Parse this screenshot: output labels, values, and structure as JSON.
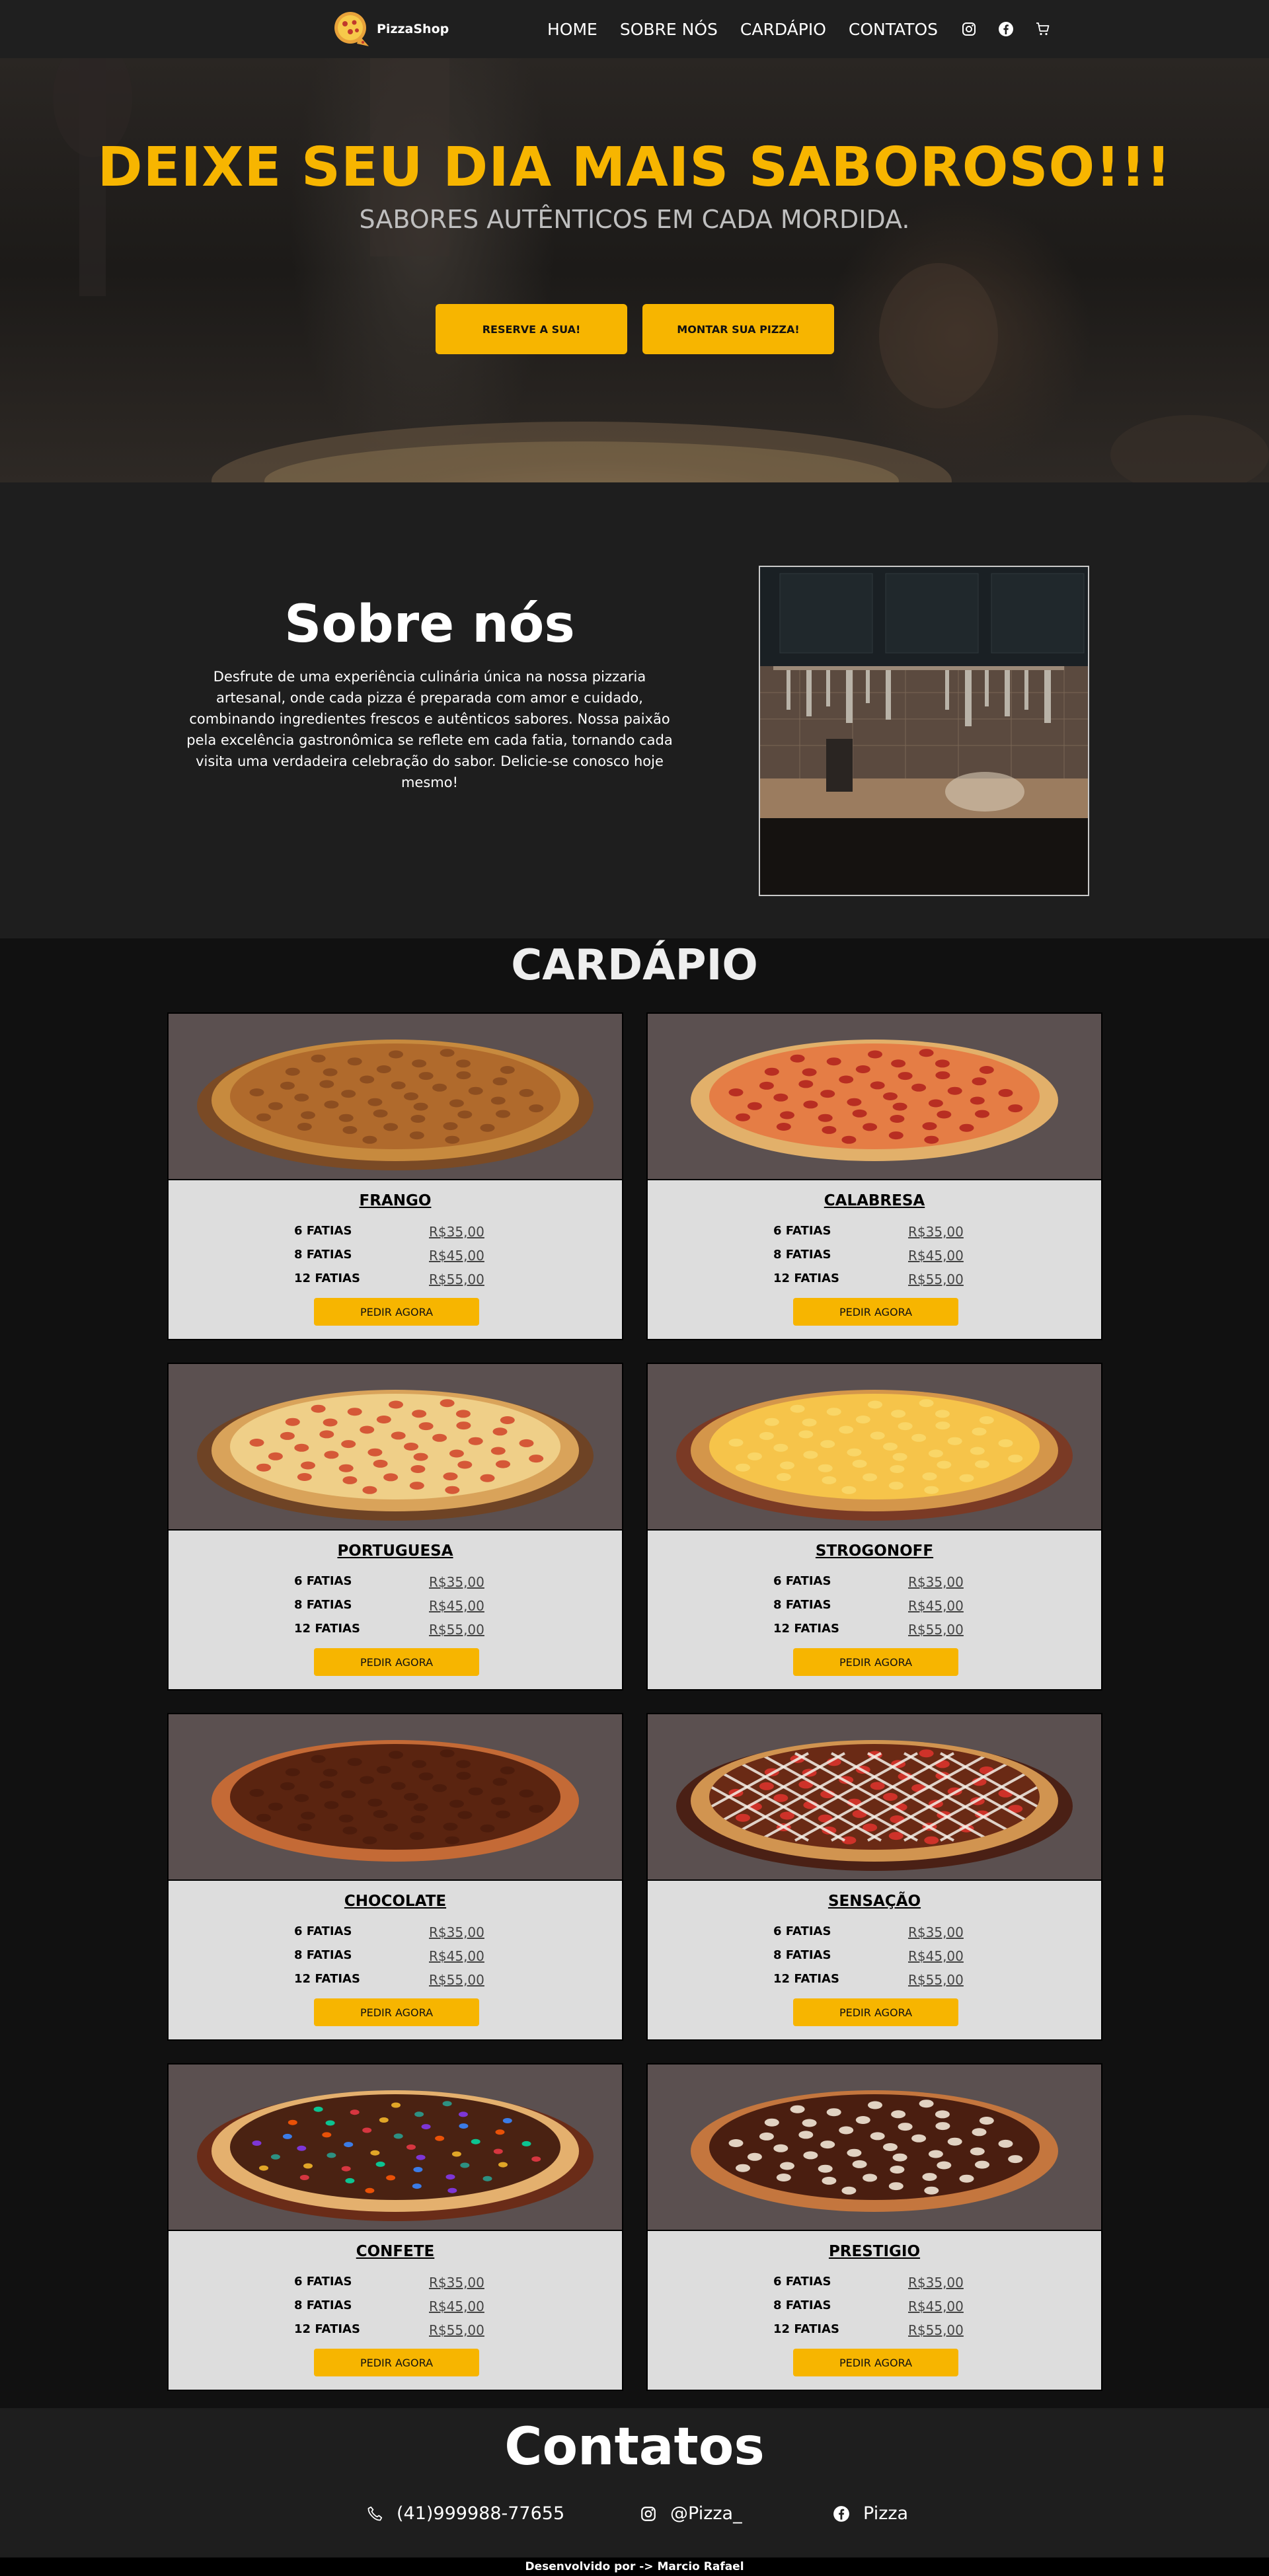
{
  "nav": {
    "brand": "PizzaShop",
    "links": [
      "HOME",
      "SOBRE NÓS",
      "CARDÁPIO",
      "CONTATOS"
    ],
    "icons": [
      "instagram-icon",
      "facebook-icon",
      "cart-icon"
    ]
  },
  "hero": {
    "title": "DEIXE SEU DIA MAIS SABOROSO!!!",
    "subtitle": "SABORES AUTÊNTICOS EM CADA MORDIDA.",
    "btn_reserve": "RESERVE A SUA!",
    "btn_build": "MONTAR SUA PIZZA!"
  },
  "about": {
    "title": "Sobre nós",
    "text": "Desfrute de uma experiência culinária única na nossa pizzaria artesanal, onde cada pizza é preparada com amor e cuidado, combinando ingredientes frescos e autênticos sabores. Nossa paixão pela excelência gastronômica se reflete em cada fatia, tornando cada visita uma verdadeira celebração do sabor. Delicie-se conosco hoje mesmo!"
  },
  "menu": {
    "title": "CARDÁPIO",
    "order_label": "PEDIR AGORA",
    "items": [
      {
        "name": "FRANGO",
        "prices": [
          {
            "label": "6 FATIAS",
            "value": "R$35,00"
          },
          {
            "label": "8 FATIAS",
            "value": "R$45,00"
          },
          {
            "label": "12 FATIAS",
            "value": "R$55,00"
          }
        ]
      },
      {
        "name": "CALABRESA",
        "prices": [
          {
            "label": "6 FATIAS",
            "value": "R$35,00"
          },
          {
            "label": "8 FATIAS",
            "value": "R$45,00"
          },
          {
            "label": "12 FATIAS",
            "value": "R$55,00"
          }
        ]
      },
      {
        "name": "PORTUGUESA",
        "prices": [
          {
            "label": "6 FATIAS",
            "value": "R$35,00"
          },
          {
            "label": "8 FATIAS",
            "value": "R$45,00"
          },
          {
            "label": "12 FATIAS",
            "value": "R$55,00"
          }
        ]
      },
      {
        "name": "STROGONOFF",
        "prices": [
          {
            "label": "6 FATIAS",
            "value": "R$35,00"
          },
          {
            "label": "8 FATIAS",
            "value": "R$45,00"
          },
          {
            "label": "12 FATIAS",
            "value": "R$55,00"
          }
        ]
      },
      {
        "name": "CHOCOLATE",
        "prices": [
          {
            "label": "6 FATIAS",
            "value": "R$35,00"
          },
          {
            "label": "8 FATIAS",
            "value": "R$45,00"
          },
          {
            "label": "12 FATIAS",
            "value": "R$55,00"
          }
        ]
      },
      {
        "name": "SENSAÇÃO",
        "prices": [
          {
            "label": "6 FATIAS",
            "value": "R$35,00"
          },
          {
            "label": "8 FATIAS",
            "value": "R$45,00"
          },
          {
            "label": "12 FATIAS",
            "value": "R$55,00"
          }
        ]
      },
      {
        "name": "CONFETE",
        "prices": [
          {
            "label": "6 FATIAS",
            "value": "R$35,00"
          },
          {
            "label": "8 FATIAS",
            "value": "R$45,00"
          },
          {
            "label": "12 FATIAS",
            "value": "R$55,00"
          }
        ]
      },
      {
        "name": "PRESTIGIO",
        "prices": [
          {
            "label": "6 FATIAS",
            "value": "R$35,00"
          },
          {
            "label": "8 FATIAS",
            "value": "R$45,00"
          },
          {
            "label": "12 FATIAS",
            "value": "R$55,00"
          }
        ]
      }
    ]
  },
  "contact": {
    "title": "Contatos",
    "phone": "(41)999988-77655",
    "instagram": "@Pizza_",
    "facebook": "Pizza"
  },
  "footer": {
    "text": "Desenvolvido por -> Marcio Rafael"
  },
  "colors": {
    "accent": "#f7b500",
    "card_bg": "#dddddd",
    "card_img_bg": "#5b5050",
    "dark": "#1e1e1e"
  }
}
